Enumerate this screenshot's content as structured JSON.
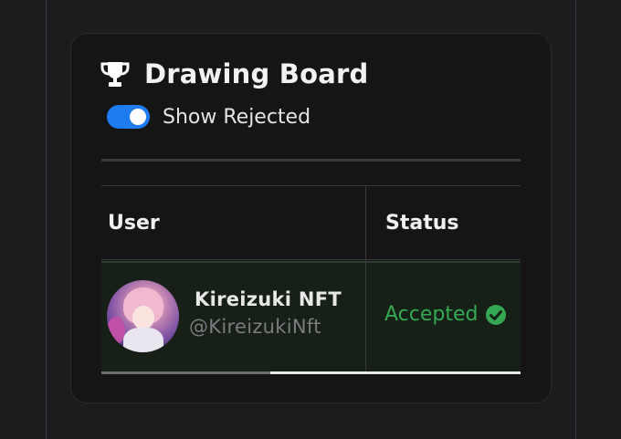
{
  "panel": {
    "title": "Drawing Board",
    "trophy_icon": "trophy-icon"
  },
  "toggle": {
    "label": "Show Rejected",
    "checked": true,
    "color": "#1e7bf2"
  },
  "table": {
    "columns": [
      "User",
      "Status"
    ],
    "rows": [
      {
        "name": "Kireizuki NFT",
        "handle": "@KireizukiNft",
        "status": "Accepted",
        "status_color": "#34a853",
        "status_icon": "check-circle-icon"
      }
    ]
  }
}
